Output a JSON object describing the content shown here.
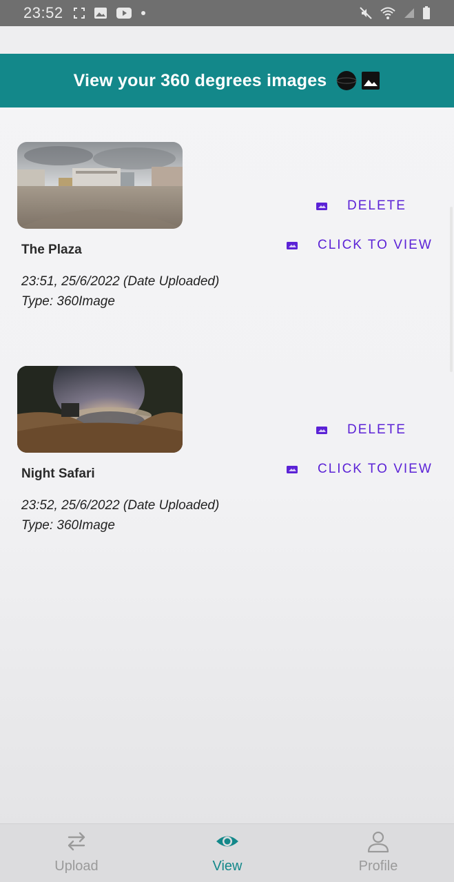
{
  "status_bar": {
    "time": "23:52",
    "left_icons": [
      "screenshot-icon",
      "gallery-icon",
      "youtube-icon",
      "dot-icon"
    ],
    "right_icons": [
      "mute-icon",
      "wifi-icon",
      "signal-icon",
      "battery-icon"
    ]
  },
  "header": {
    "title": "View your 360 degrees images",
    "icons": [
      "globe-icon",
      "image-icon"
    ],
    "background": "#13888a"
  },
  "items": [
    {
      "title": "The Plaza",
      "date": "23:51, 25/6/2022 (Date Uploaded)",
      "type": "Type: 360Image",
      "delete_label": "DELETE",
      "view_label": "CLICK TO VIEW",
      "thumbnail": "plaza-panorama"
    },
    {
      "title": "Night Safari",
      "date": "23:52, 25/6/2022 (Date Uploaded)",
      "type": "Type: 360Image",
      "delete_label": "DELETE",
      "view_label": "CLICK TO VIEW",
      "thumbnail": "night-safari-panorama"
    }
  ],
  "action_color": "#5b22d6",
  "bottom_nav": {
    "items": [
      {
        "label": "Upload",
        "icon": "swap-arrows-icon",
        "active": false
      },
      {
        "label": "View",
        "icon": "eye-icon",
        "active": true
      },
      {
        "label": "Profile",
        "icon": "person-icon",
        "active": false
      }
    ],
    "active_color": "#13888a"
  }
}
